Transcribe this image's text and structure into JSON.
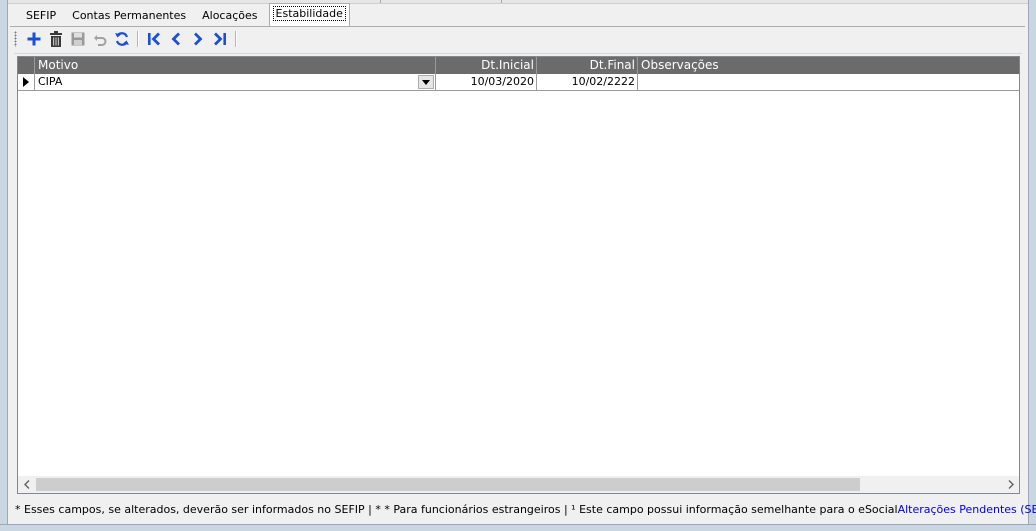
{
  "tabs": [
    {
      "label": "SEFIP",
      "active": false
    },
    {
      "label": "Contas Permanentes",
      "active": false
    },
    {
      "label": "Alocações",
      "active": false
    },
    {
      "label": "Estabilidade",
      "active": true
    }
  ],
  "toolbar": {
    "buttons": [
      {
        "name": "add",
        "icon": "plus-icon",
        "enabled": true,
        "color": "#1a4fd6"
      },
      {
        "name": "delete",
        "icon": "trash-icon",
        "enabled": true,
        "color": "#3a3a3a"
      },
      {
        "name": "save",
        "icon": "floppy-icon",
        "enabled": false,
        "color": "#9a9a9a"
      },
      {
        "name": "undo",
        "icon": "undo-icon",
        "enabled": false,
        "color": "#9a9a9a"
      },
      {
        "name": "refresh",
        "icon": "refresh-icon",
        "enabled": true,
        "color": "#1a4fd6"
      },
      {
        "name": "first",
        "icon": "first-record-icon",
        "enabled": true,
        "color": "#1a4fd6"
      },
      {
        "name": "previous",
        "icon": "previous-record-icon",
        "enabled": true,
        "color": "#1a4fd6"
      },
      {
        "name": "next",
        "icon": "next-record-icon",
        "enabled": true,
        "color": "#1a4fd6"
      },
      {
        "name": "last",
        "icon": "last-record-icon",
        "enabled": true,
        "color": "#1a4fd6"
      }
    ]
  },
  "grid": {
    "columns": [
      {
        "key": "motivo",
        "label": "Motivo",
        "align": "left"
      },
      {
        "key": "dt_inicial",
        "label": "Dt.Inicial",
        "align": "right"
      },
      {
        "key": "dt_final",
        "label": "Dt.Final",
        "align": "right"
      },
      {
        "key": "observacoes",
        "label": "Observações",
        "align": "left"
      }
    ],
    "rows": [
      {
        "motivo": "CIPA",
        "dt_inicial": "10/03/2020",
        "dt_final": "10/02/2222",
        "observacoes": "",
        "current": true
      }
    ],
    "header_color": "#6b6b6b"
  },
  "status": {
    "legend": "* Esses campos, se alterados, deverão ser informados no SEFIP | * * Para funcionários estrangeiros |  ¹  Este campo possui informação semelhante para o eSocial",
    "link": "Alterações Pendentes (SEFIP)",
    "link_color": "#0000e6"
  }
}
